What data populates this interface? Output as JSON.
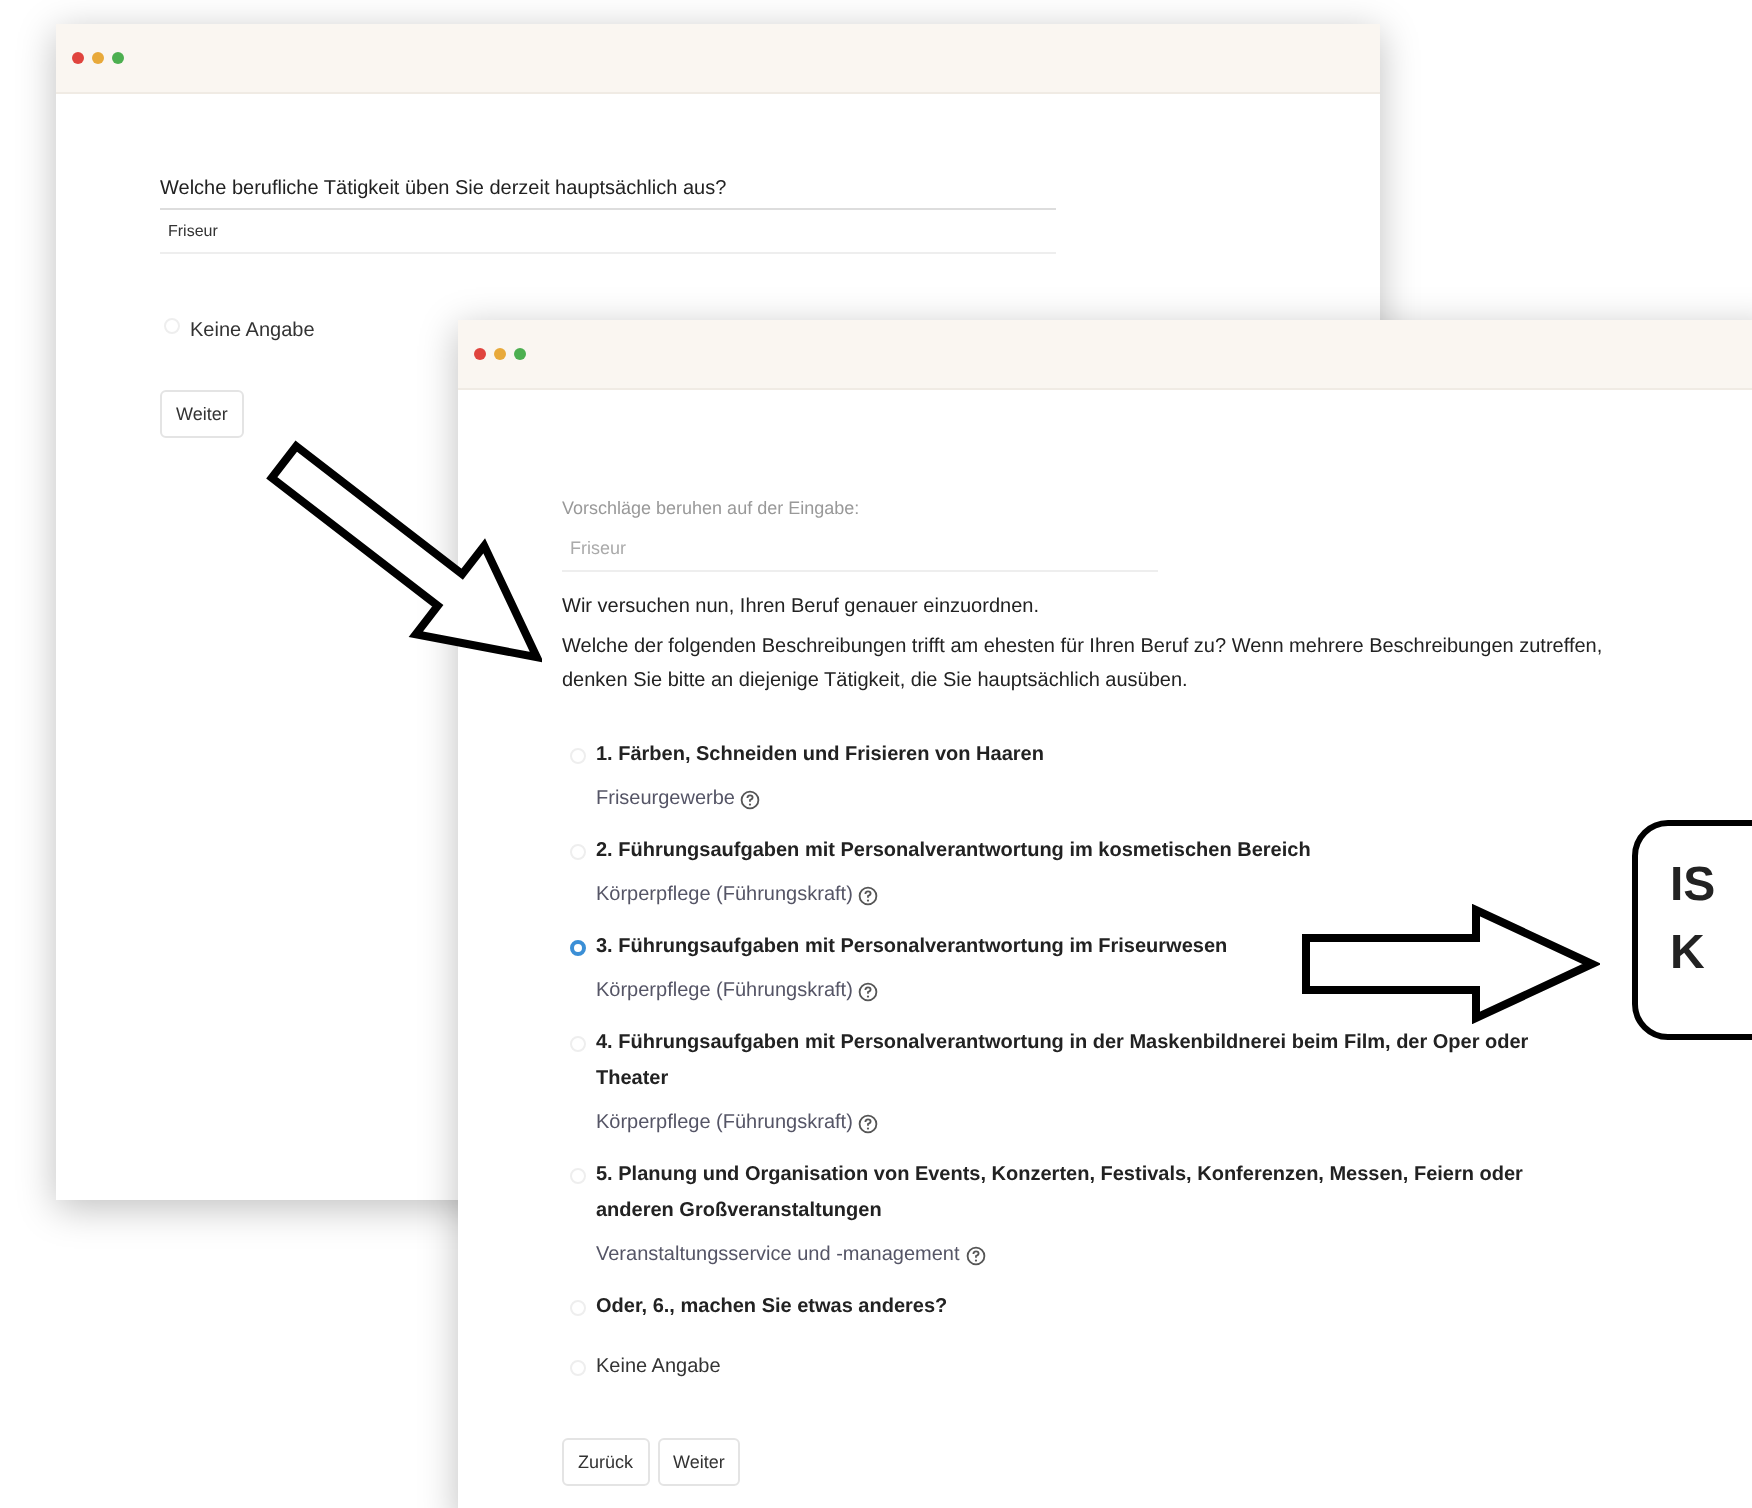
{
  "back_window": {
    "question": "Welche berufliche Tätigkeit üben Sie derzeit hauptsächlich aus?",
    "answer_value": "Friseur",
    "no_answer": {
      "label": "Keine Angabe",
      "selected": false
    },
    "buttons": [
      "Weiter"
    ]
  },
  "front_window": {
    "suggestion_label": "Vorschläge beruhen auf der Eingabe:",
    "suggestion_value": "Friseur",
    "intro": "Wir versuchen nun, Ihren Beruf genauer einzuordnen.",
    "question": "Welche der folgenden Beschreibungen trifft am ehesten für Ihren Beruf zu? Wenn mehrere Beschreibungen zutreffen, denken Sie bitte an diejenige Tätigkeit, die Sie hauptsächlich ausüben.",
    "options": [
      {
        "kind": "described",
        "label": "1. Färben, Schneiden und Frisieren von Haaren",
        "category": "Friseurgewerbe",
        "selected": false
      },
      {
        "kind": "described",
        "label": "2. Führungsaufgaben mit Personalverantwortung im kosmetischen Bereich",
        "category": "Körperpflege (Führungskraft)",
        "selected": false
      },
      {
        "kind": "described",
        "label": "3. Führungsaufgaben mit Personalverantwortung im Friseurwesen",
        "category": "Körperpflege (Führungskraft)",
        "selected": true
      },
      {
        "kind": "described",
        "label": "4. Führungsaufgaben mit Personalverantwortung in der Maskenbildnerei beim Film, der Oper oder Theater",
        "category": "Körperpflege (Führungskraft)",
        "selected": false
      },
      {
        "kind": "described",
        "label": "5. Planung und Organisation von Events, Konzerten, Festivals, Konferenzen, Messen, Feiern oder anderen Großveranstaltungen",
        "category": "Veranstaltungsservice und -management",
        "selected": false
      },
      {
        "kind": "other",
        "label": "Oder, 6., machen Sie etwas anderes?",
        "selected": false
      },
      {
        "kind": "plain",
        "label": "Keine Angabe",
        "selected": false
      }
    ],
    "buttons": [
      "Zurück",
      "Weiter"
    ]
  },
  "callout": {
    "lines": [
      "IS",
      "K"
    ]
  }
}
